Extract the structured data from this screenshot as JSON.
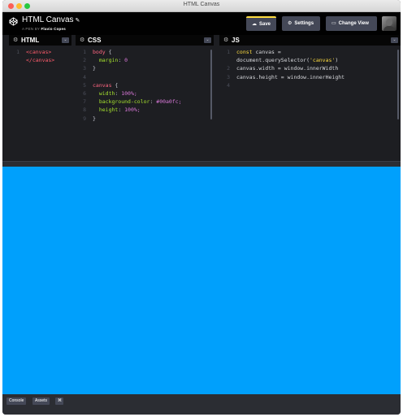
{
  "window": {
    "title": "HTML Canvas"
  },
  "header": {
    "pen_title": "HTML Canvas",
    "pen_title_icon": "pencil-icon",
    "author_prefix": "A PEN BY",
    "author_name": "Flavio Copes",
    "buttons": {
      "save": {
        "label": "Save",
        "icon": "cloud-icon"
      },
      "settings": {
        "label": "Settings",
        "icon": "gear-icon"
      },
      "change_view": {
        "label": "Change View",
        "icon": "layout-icon"
      }
    }
  },
  "editors": {
    "html": {
      "label": "HTML",
      "lines": [
        {
          "num": "1",
          "text": "<canvas>"
        },
        {
          "num": "",
          "text": "</canvas>"
        }
      ]
    },
    "css": {
      "label": "CSS",
      "lines": [
        {
          "num": "1",
          "selector": "body",
          "brace": " {"
        },
        {
          "num": "2",
          "prop": "margin",
          "value": "0"
        },
        {
          "num": "3",
          "text": "}"
        },
        {
          "num": "4",
          "text": ""
        },
        {
          "num": "5",
          "selector": "canvas",
          "brace": " {"
        },
        {
          "num": "6",
          "prop": "width",
          "value": "100%;"
        },
        {
          "num": "7",
          "prop": "background-color",
          "value": "#00a0fc;"
        },
        {
          "num": "8",
          "prop": "height",
          "value": "100%;"
        },
        {
          "num": "9",
          "text": "}"
        }
      ]
    },
    "js": {
      "label": "JS",
      "lines": [
        {
          "num": "1",
          "kw": "const",
          "text": " canvas ="
        },
        {
          "num": "",
          "pre": "document.querySelector(",
          "str": "'canvas'",
          "post": ")"
        },
        {
          "num": "2",
          "text": "canvas.width = window.innerWidth"
        },
        {
          "num": "3",
          "text": "canvas.height = window.innerHeight"
        },
        {
          "num": "4",
          "text": ""
        }
      ]
    }
  },
  "result": {
    "background": "#00a0fc"
  },
  "footer": {
    "console": "Console",
    "assets": "Assets",
    "shortcuts": "⌘"
  },
  "colors": {
    "accent": "#ffdd40",
    "header_bg": "#010101",
    "editor_bg": "#1d1e22"
  }
}
